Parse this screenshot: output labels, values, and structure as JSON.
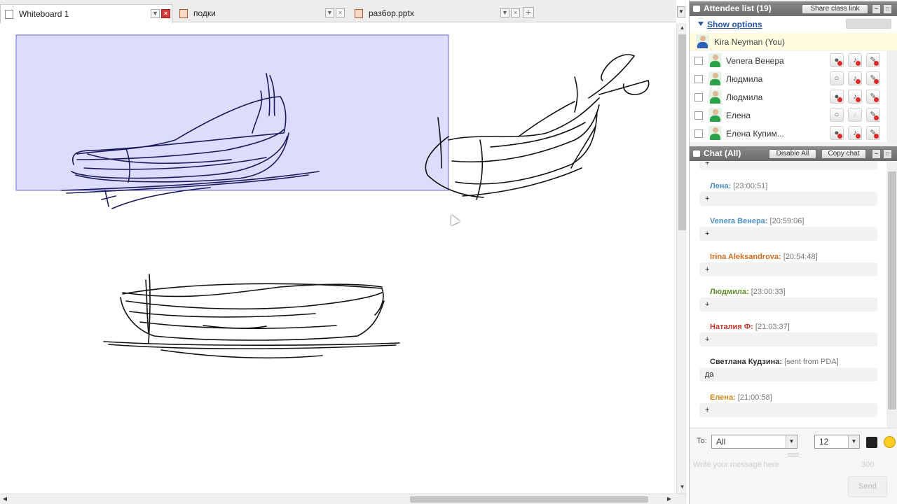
{
  "tabs": {
    "tab1": {
      "label": "Whiteboard 1"
    },
    "tab2": {
      "label": "подки"
    },
    "tab3": {
      "label": "разбор.pptx"
    },
    "add_label": "+"
  },
  "attendees": {
    "title": "Attendee list (19)",
    "share_label": "Share class link",
    "show_options": "Show options",
    "me": "Kira Neyman (You)",
    "list": [
      {
        "name": "Venera Венера"
      },
      {
        "name": "Людмила"
      },
      {
        "name": "Людмила"
      },
      {
        "name": "Елена"
      },
      {
        "name": "Елена Купим..."
      }
    ]
  },
  "chat": {
    "title": "Chat (All)",
    "disable_all": "Disable All",
    "copy_chat": "Copy chat",
    "top_text": "+",
    "messages": [
      {
        "author": "Лена:",
        "time": "[23:00:51]",
        "text": "+",
        "color": "#4a90c8"
      },
      {
        "author": "Venera Венера:",
        "time": "[20:59:06]",
        "text": "+",
        "color": "#4a90c8"
      },
      {
        "author": "Irina Aleksandrova:",
        "time": "[20:54:48]",
        "text": "+",
        "color": "#d06a1e"
      },
      {
        "author": "Людмила:",
        "time": "[23:00:33]",
        "text": "+",
        "color": "#5e8f2a"
      },
      {
        "author": "Наталия Ф:",
        "time": "[21:03:37]",
        "text": "+",
        "color": "#c0392b"
      },
      {
        "author": "Светлана Кудзина:",
        "time": "[sent from PDA]",
        "text": "да",
        "color": "#333333"
      },
      {
        "author": "Елена:",
        "time": "[21:00:58]",
        "text": "+",
        "color": "#d08a1e"
      }
    ],
    "to_label": "To:",
    "to_value": "All",
    "font_size": "12",
    "input_placeholder": "Write your message here",
    "char_count": "300",
    "send_label": "Send"
  },
  "colors": {
    "selection_fill": "#dcdcfc",
    "selection_stroke": "#6b6bd6",
    "ink": "#111111",
    "ink_selected": "#1a1a5a",
    "close_red": "#d43a3a",
    "link_blue": "#2457a8"
  }
}
